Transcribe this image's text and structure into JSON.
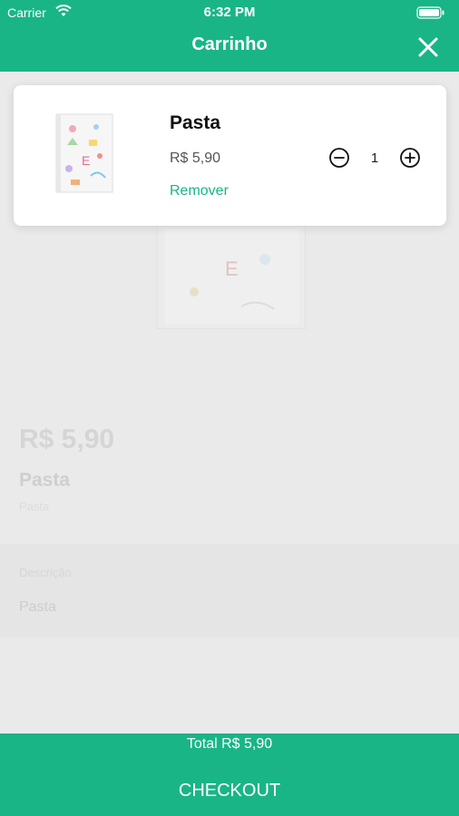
{
  "status_bar": {
    "carrier": "Carrier",
    "time": "6:32 PM"
  },
  "header": {
    "title": "Carrinho"
  },
  "background_product": {
    "price": "R$ 5,90",
    "name": "Pasta",
    "subtitle": "Pasta",
    "section_label": "Descrição",
    "section_value": "Pasta"
  },
  "cart": {
    "items": [
      {
        "name": "Pasta",
        "price": "R$ 5,90",
        "quantity": "1",
        "remove_label": "Remover"
      }
    ]
  },
  "footer": {
    "total": "Total R$ 5,90",
    "checkout_label": "CHECKOUT"
  },
  "colors": {
    "accent": "#19b587"
  },
  "icons": [
    "wifi-icon",
    "battery-icon",
    "close-icon",
    "minus-circle-icon",
    "plus-circle-icon"
  ]
}
